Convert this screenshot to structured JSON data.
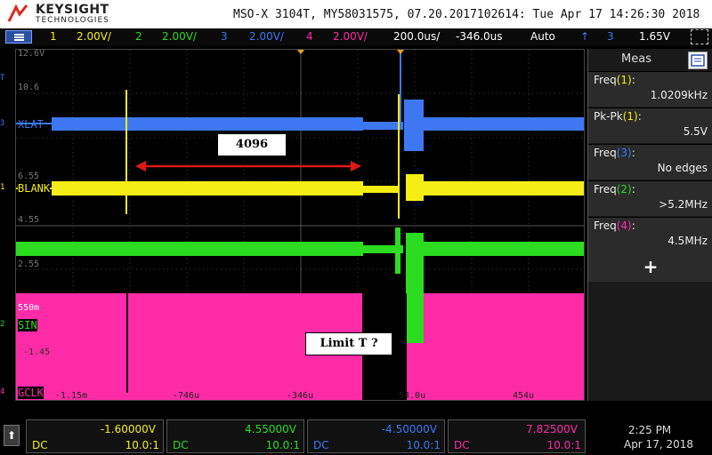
{
  "header": {
    "brand": "KEYSIGHT",
    "brand_sub": "TECHNOLOGIES",
    "title": "MSO-X 3104T, MY58031575, 07.20.2017102614: Tue Apr 17 14:26:30 2018"
  },
  "channel_bar": {
    "ch1_num": "1",
    "ch1_scale": "2.00V/",
    "ch2_num": "2",
    "ch2_scale": "2.00V/",
    "ch3_num": "3",
    "ch3_scale": "2.00V/",
    "ch4_num": "4",
    "ch4_scale": "2.00V/",
    "timebase": "200.0us/",
    "delay": "-346.0us",
    "trigger_mode": "Auto",
    "trigger_icon": "rising-edge-icon",
    "trigger_source": "3",
    "trigger_level": "1.65V"
  },
  "colors": {
    "ch1": "#f5ee16",
    "ch2": "#2bdc21",
    "ch3": "#3d78f2",
    "ch4": "#ff2ba7",
    "annotation_arrow": "#e11818",
    "marker": "#f0a020"
  },
  "grid": {
    "y_labels": [
      "12.6V",
      "10.6",
      "6.55",
      "4.55",
      "2.55",
      "550m",
      "-1.45"
    ],
    "x_labels": [
      "-1.15m",
      "-746u",
      "-346u",
      "54.0u",
      "454u"
    ]
  },
  "traces": {
    "ch3_label": "XLAT",
    "ch1_label": "BLANK",
    "ch2_label": "SIN",
    "ch4_label": "GCLK",
    "ch3_mark": "3",
    "ch1_mark": "1",
    "ch2_mark": "2",
    "ch4_mark": "4"
  },
  "annotations": {
    "box1": "4096",
    "box2": "Limit T ?"
  },
  "meas": {
    "title": "Meas",
    "rows": [
      {
        "name": "Freq",
        "ch": "(1)",
        "value": "1.0209kHz",
        "color": "#f5ee16"
      },
      {
        "name": "Pk-Pk",
        "ch": "(1)",
        "value": "5.5V",
        "color": "#f5ee16"
      },
      {
        "name": "Freq",
        "ch": "(3)",
        "value": "No edges",
        "color": "#3d78f2"
      },
      {
        "name": "Freq",
        "ch": "(2)",
        "value": ">5.2MHz",
        "color": "#2bdc21"
      },
      {
        "name": "Freq",
        "ch": "(4)",
        "value": "4.5MHz",
        "color": "#ff2ba7"
      }
    ],
    "add_label": "+"
  },
  "footer": {
    "up_icon": "up-arrow-icon",
    "ch1": {
      "value": "-1.60000V",
      "coupling": "DC",
      "ratio": "10.0:1"
    },
    "ch2": {
      "value": "4.55000V",
      "coupling": "DC",
      "ratio": "10.0:1"
    },
    "ch3": {
      "value": "-4.50000V",
      "coupling": "DC",
      "ratio": "10.0:1"
    },
    "ch4": {
      "value": "7.82500V",
      "coupling": "DC",
      "ratio": "10.0:1"
    },
    "time": "2:25 PM",
    "date": "Apr 17, 2018"
  }
}
